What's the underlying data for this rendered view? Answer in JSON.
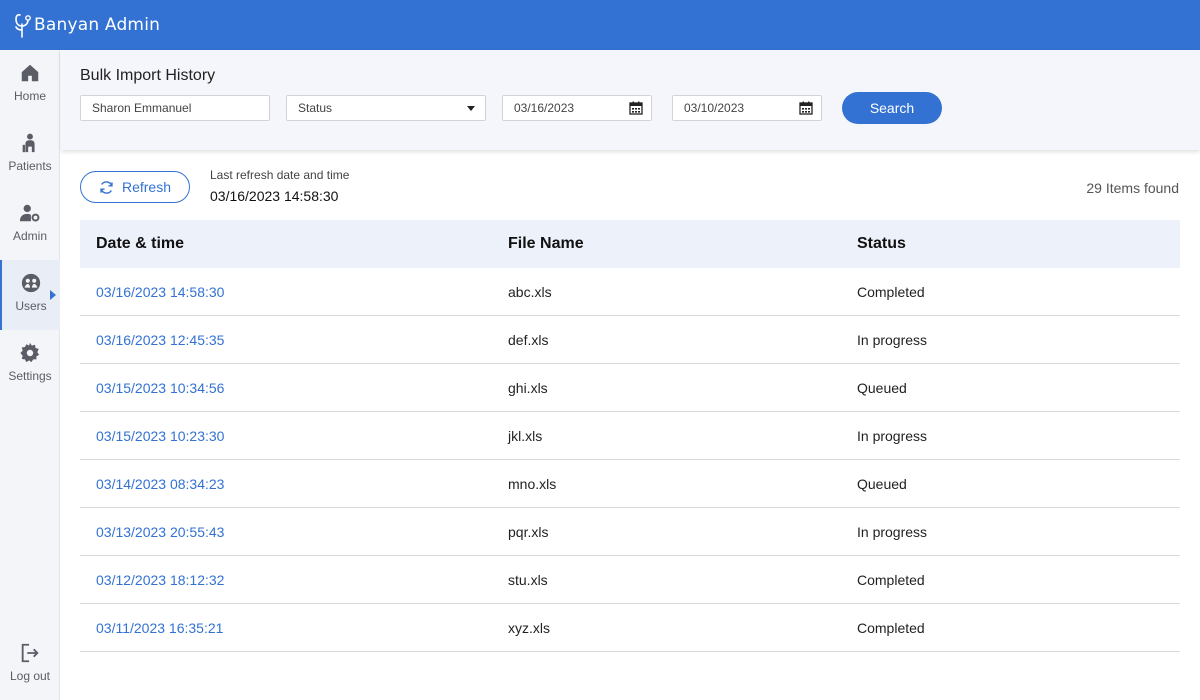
{
  "app": {
    "name": "Banyan Admin"
  },
  "sidebar": {
    "items": [
      {
        "label": "Home",
        "icon": "home-icon"
      },
      {
        "label": "Patients",
        "icon": "patient-icon"
      },
      {
        "label": "Admin",
        "icon": "admin-icon"
      },
      {
        "label": "Users",
        "icon": "users-icon",
        "active": true
      },
      {
        "label": "Settings",
        "icon": "gear-icon"
      }
    ],
    "logout_label": "Log out"
  },
  "filters": {
    "title": "Bulk Import History",
    "name_value": "Sharon Emmanuel",
    "status_value": "Status",
    "date_from": "03/16/2023",
    "date_to": "03/10/2023",
    "search_label": "Search"
  },
  "refresh": {
    "button_label": "Refresh",
    "last_label": "Last refresh date and time",
    "last_value": "03/16/2023 14:58:30",
    "items_found": "29 Items found"
  },
  "table": {
    "headers": [
      "Date & time",
      "File Name",
      "Status"
    ],
    "rows": [
      [
        "03/16/2023 14:58:30",
        "abc.xls",
        "Completed"
      ],
      [
        "03/16/2023 12:45:35",
        "def.xls",
        "In progress"
      ],
      [
        "03/15/2023 10:34:56",
        "ghi.xls",
        "Queued"
      ],
      [
        "03/15/2023 10:23:30",
        "jkl.xls",
        "In progress"
      ],
      [
        "03/14/2023 08:34:23",
        "mno.xls",
        "Queued"
      ],
      [
        "03/13/2023 20:55:43",
        "pqr.xls",
        "In progress"
      ],
      [
        "03/12/2023 18:12:32",
        "stu.xls",
        "Completed"
      ],
      [
        "03/11/2023 16:35:21",
        "xyz.xls",
        "Completed"
      ]
    ]
  },
  "colors": {
    "brand": "#3372d2",
    "sidebar_bg": "#f4f5f8",
    "header_row_bg": "#edf2fa"
  }
}
